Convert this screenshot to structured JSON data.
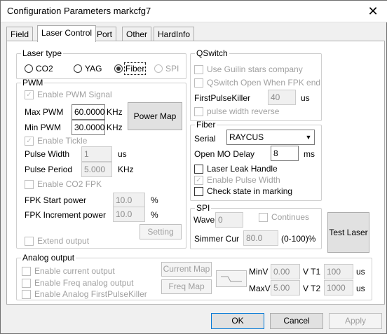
{
  "window": {
    "title": "Configuration Parameters markcfg7"
  },
  "tabs": [
    "Field",
    "Laser Control",
    "Port",
    "Other",
    "HardInfo"
  ],
  "laser_type": {
    "legend": "Laser type",
    "options": [
      "CO2",
      "YAG",
      "Fiber",
      "SPI"
    ],
    "selected": "Fiber"
  },
  "pwm": {
    "legend": "PWM",
    "enable_pwm": "Enable PWM Signal",
    "max_pwm_label": "Max PWM",
    "max_pwm_value": "60.0000",
    "max_pwm_unit": "KHz",
    "min_pwm_label": "Min PWM",
    "min_pwm_value": "30.0000",
    "min_pwm_unit": "KHz",
    "power_map": "Power Map",
    "enable_tickle": "Enable Tickle",
    "pulse_width_label": "Pulse Width",
    "pulse_width_value": "1",
    "pulse_width_unit": "us",
    "pulse_period_label": "Pulse Period",
    "pulse_period_value": "5.000",
    "pulse_period_unit": "KHz",
    "enable_co2_fpk": "Enable CO2 FPK",
    "fpk_start_label": "FPK Start power",
    "fpk_start_value": "10.0",
    "fpk_start_unit": "%",
    "fpk_inc_label": "FPK Increment power",
    "fpk_inc_value": "10.0",
    "fpk_inc_unit": "%",
    "setting": "Setting",
    "extend_output": "Extend output"
  },
  "qswitch": {
    "legend": "QSwitch",
    "use_guilin": "Use Guilin stars company",
    "qswitch_open": "QSwitch Open When FPK end",
    "fpk_label": "FirstPulseKiller",
    "fpk_value": "40",
    "fpk_unit": "us",
    "pulse_width_reverse": "pulse width reverse"
  },
  "fiber": {
    "legend": "Fiber",
    "serial_label": "Serial",
    "serial_value": "RAYCUS",
    "open_mo_label": "Open MO Delay",
    "open_mo_value": "8",
    "open_mo_unit": "ms",
    "laser_leak": "Laser Leak Handle",
    "enable_pulse_width": "Enable Pulse Width",
    "check_state": "Check state in marking"
  },
  "spi": {
    "legend": "SPI",
    "wave_label": "Wave",
    "wave_value": "0",
    "continues": "Continues",
    "simmer_label": "Simmer Cur",
    "simmer_value": "80.0",
    "simmer_unit": "(0-100)%"
  },
  "test_laser": "Test Laser",
  "analog": {
    "legend": "Analog output",
    "enable_current": "Enable current output",
    "enable_freq": "Enable Freq analog output",
    "enable_fpk": "Enable Analog FirstPulseKiller",
    "current_map": "Current Map",
    "freq_map": "Freq Map",
    "minv_label": "MinV",
    "minv_value": "0.00",
    "maxv_label": "MaxV",
    "maxv_value": "5.00",
    "t1_label": "V  T1",
    "t1_value": "100",
    "t2_label": "V  T2",
    "t2_value": "1000",
    "us": "us"
  },
  "footer": {
    "ok": "OK",
    "cancel": "Cancel",
    "apply": "Apply"
  }
}
